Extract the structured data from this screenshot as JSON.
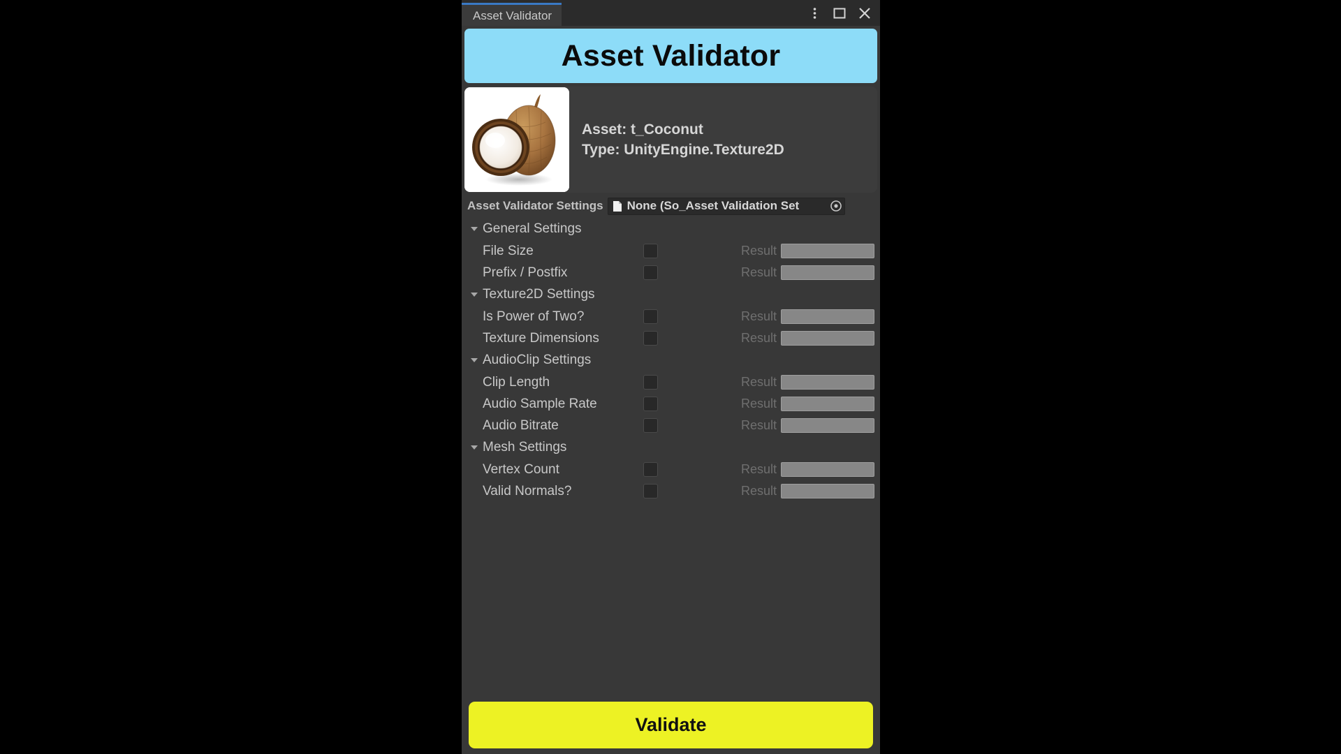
{
  "window": {
    "tab_label": "Asset Validator",
    "controls": [
      {
        "name": "kebab-menu-icon",
        "label": "⋮"
      },
      {
        "name": "maximize-icon",
        "label": "□"
      },
      {
        "name": "close-icon",
        "label": "✕"
      }
    ],
    "accent_color": "#3a79c4",
    "chrome_color": "#2b2b2b",
    "body_color": "#383838"
  },
  "banner": {
    "title": "Asset Validator",
    "background": "#8ddcf8",
    "text_color": "#0b0b0b"
  },
  "asset": {
    "thumbnail_name": "coconut-texture-thumbnail",
    "name_line": "Asset: t_Coconut",
    "type_line": "Type: UnityEngine.Texture2D"
  },
  "settings": {
    "label": "Asset Validator Settings",
    "object_field_value": "None (So_Asset Validation Set",
    "object_field_icon": "scriptable-object-document-icon",
    "picker_icon": "object-picker-target-icon"
  },
  "groups": [
    {
      "title": "General Settings",
      "expanded": true,
      "rows": [
        {
          "label": "File Size",
          "checked": false,
          "result_label": "Result",
          "result_value": ""
        },
        {
          "label": "Prefix / Postfix",
          "checked": false,
          "result_label": "Result",
          "result_value": ""
        }
      ]
    },
    {
      "title": "Texture2D Settings",
      "expanded": true,
      "rows": [
        {
          "label": "Is Power of Two?",
          "checked": false,
          "result_label": "Result",
          "result_value": ""
        },
        {
          "label": "Texture Dimensions",
          "checked": false,
          "result_label": "Result",
          "result_value": ""
        }
      ]
    },
    {
      "title": "AudioClip Settings",
      "expanded": true,
      "rows": [
        {
          "label": "Clip Length",
          "checked": false,
          "result_label": "Result",
          "result_value": ""
        },
        {
          "label": "Audio Sample Rate",
          "checked": false,
          "result_label": "Result",
          "result_value": ""
        },
        {
          "label": "Audio Bitrate",
          "checked": false,
          "result_label": "Result",
          "result_value": ""
        }
      ]
    },
    {
      "title": "Mesh Settings",
      "expanded": true,
      "rows": [
        {
          "label": "Vertex Count",
          "checked": false,
          "result_label": "Result",
          "result_value": ""
        },
        {
          "label": "Valid Normals?",
          "checked": false,
          "result_label": "Result",
          "result_value": ""
        }
      ]
    }
  ],
  "footer": {
    "validate_label": "Validate",
    "validate_color": "#edf224"
  }
}
